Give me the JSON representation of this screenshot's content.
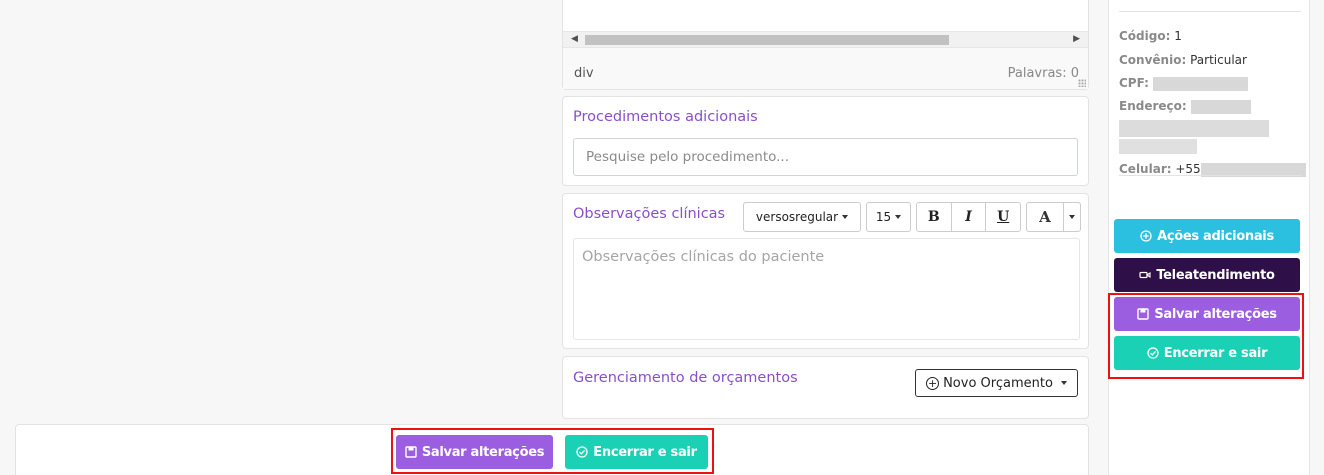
{
  "editor": {
    "path": "div",
    "word_count": "Palavras: 0"
  },
  "procedimentos": {
    "title": "Procedimentos adicionais",
    "search_placeholder": "Pesquise pelo procedimento..."
  },
  "observacoes": {
    "title": "Observações clínicas",
    "font_family": "versosregular",
    "font_size": "15",
    "bold": "B",
    "italic": "I",
    "underline": "U",
    "color_letter": "A",
    "placeholder": "Observações clínicas do paciente"
  },
  "orcamentos": {
    "title": "Gerenciamento de orçamentos",
    "new_button": "Novo Orçamento"
  },
  "bottom_actions": {
    "save": "Salvar alterações",
    "finish": "Encerrar e sair"
  },
  "patient": {
    "codigo_label": "Código:",
    "codigo_value": "1",
    "convenio_label": "Convênio:",
    "convenio_value": "Particular",
    "cpf_label": "CPF:",
    "endereco_label": "Endereço:",
    "celular_label": "Celular:",
    "celular_prefix": "+55"
  },
  "sidebar_actions": {
    "acoes": "Ações adicionais",
    "tele": "Teleatendimento",
    "save": "Salvar alterações",
    "finish": "Encerrar e sair"
  },
  "colors": {
    "purple": "#9c5ee0",
    "teal": "#1ad1b5",
    "cyan": "#2bc0df",
    "dark": "#2f0f48",
    "section_title": "#8a4fc9",
    "highlight": "#ee1111"
  }
}
